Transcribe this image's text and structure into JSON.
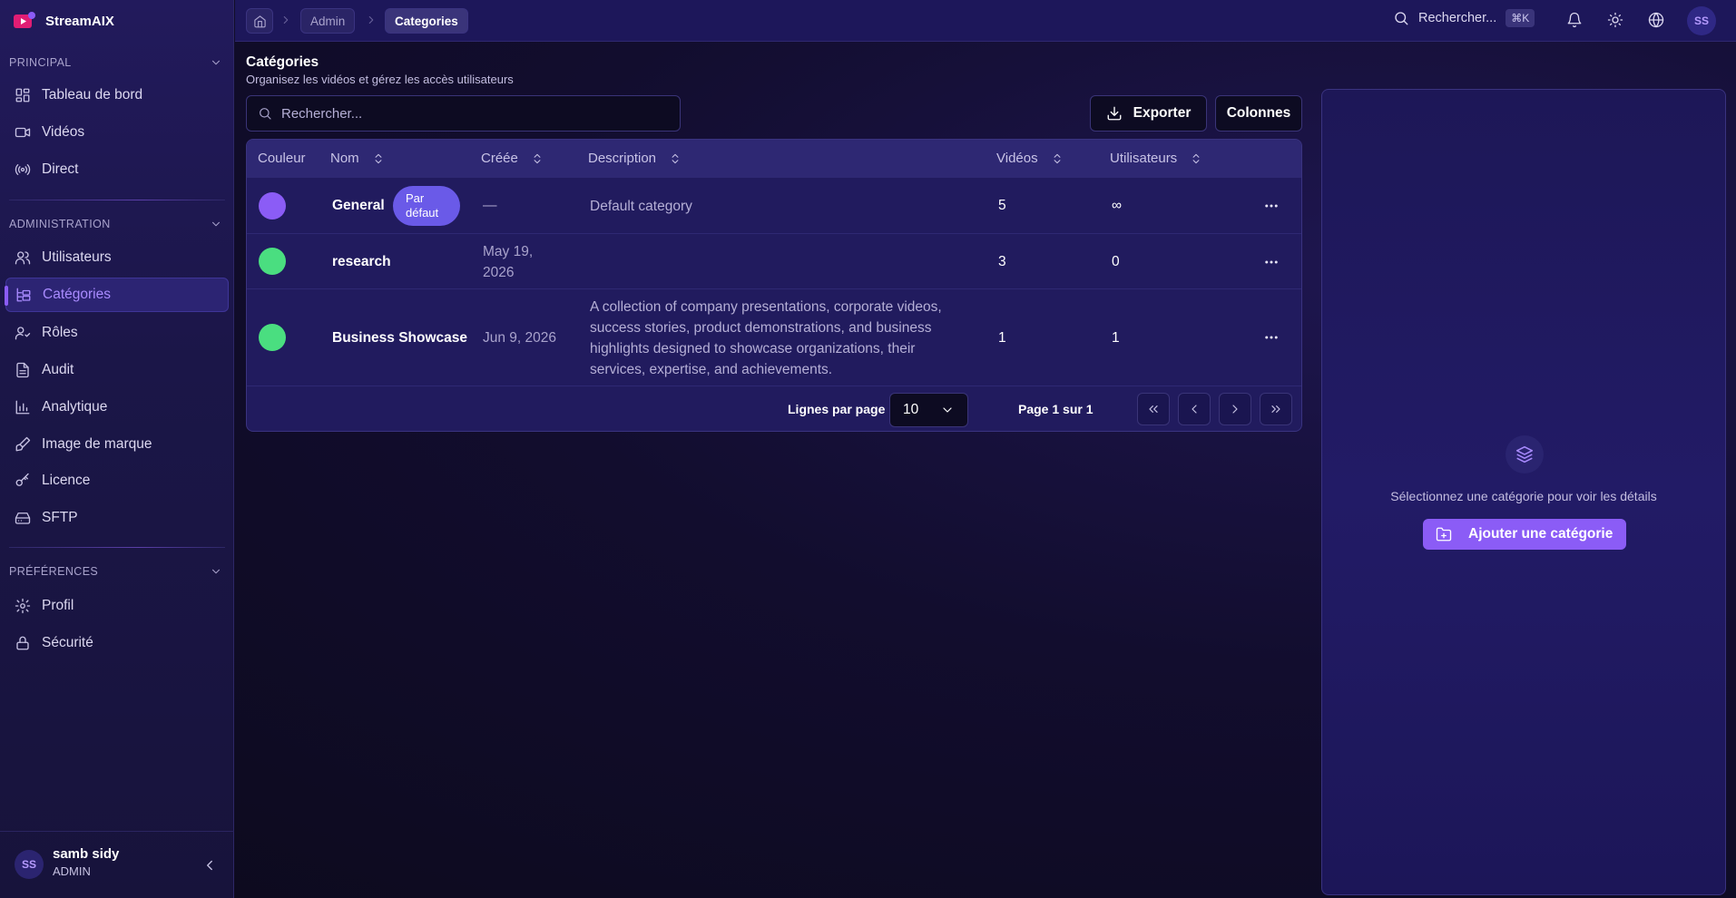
{
  "app": {
    "name": "StreamAIX"
  },
  "sidebar": {
    "sections": [
      {
        "title": "PRINCIPAL",
        "items": [
          {
            "label": "Tableau de bord",
            "icon": "dashboard-icon"
          },
          {
            "label": "Vidéos",
            "icon": "video-icon"
          },
          {
            "label": "Direct",
            "icon": "broadcast-icon"
          }
        ]
      },
      {
        "title": "ADMINISTRATION",
        "items": [
          {
            "label": "Utilisateurs",
            "icon": "users-icon"
          },
          {
            "label": "Catégories",
            "icon": "categories-icon",
            "active": true
          },
          {
            "label": "Rôles",
            "icon": "roles-icon"
          },
          {
            "label": "Audit",
            "icon": "audit-icon"
          },
          {
            "label": "Analytique",
            "icon": "chart-icon"
          },
          {
            "label": "Image de marque",
            "icon": "brush-icon"
          },
          {
            "label": "Licence",
            "icon": "key-icon"
          },
          {
            "label": "SFTP",
            "icon": "drive-icon"
          }
        ]
      },
      {
        "title": "PRÉFÉRENCES",
        "items": [
          {
            "label": "Profil",
            "icon": "gear-icon"
          },
          {
            "label": "Sécurité",
            "icon": "lock-icon"
          }
        ]
      }
    ],
    "user": {
      "initials": "SS",
      "name": "samb sidy",
      "role": "ADMIN"
    }
  },
  "topbar": {
    "breadcrumbs": [
      "Admin",
      "Categories"
    ],
    "search_label": "Rechercher...",
    "shortcut": "⌘K",
    "avatar_initials": "SS"
  },
  "page": {
    "title": "Catégories",
    "subtitle": "Organisez les vidéos et gérez les accès utilisateurs"
  },
  "toolbar": {
    "search_placeholder": "Rechercher...",
    "export_label": "Exporter",
    "columns_label": "Colonnes"
  },
  "table": {
    "headers": [
      "Couleur",
      "Nom",
      "Créée",
      "Description",
      "Vidéos",
      "Utilisateurs"
    ],
    "rows": [
      {
        "color": "#8b5cf6",
        "name": "General",
        "badge_line1": "Par",
        "badge_line2": "défaut",
        "created": "—",
        "description": "Default category",
        "videos": "5",
        "users": "∞"
      },
      {
        "color": "#4ade80",
        "name": "research",
        "created_line1": "May 19,",
        "created_line2": "2026",
        "description": "",
        "videos": "3",
        "users": "0"
      },
      {
        "color": "#4ade80",
        "name": "Business Showcase",
        "created": "Jun 9, 2026",
        "description": "A collection of company presentations, corporate videos, success stories, product demonstrations, and business highlights designed to showcase organizations, their services, expertise, and achievements.",
        "videos": "1",
        "users": "1"
      }
    ],
    "rows_per_page_label": "Lignes par page",
    "rows_per_page_value": "10",
    "page_info": "Page 1 sur 1"
  },
  "detail": {
    "empty_text": "Sélectionnez une catégorie pour voir les détails",
    "add_label": "Ajouter une catégorie"
  }
}
